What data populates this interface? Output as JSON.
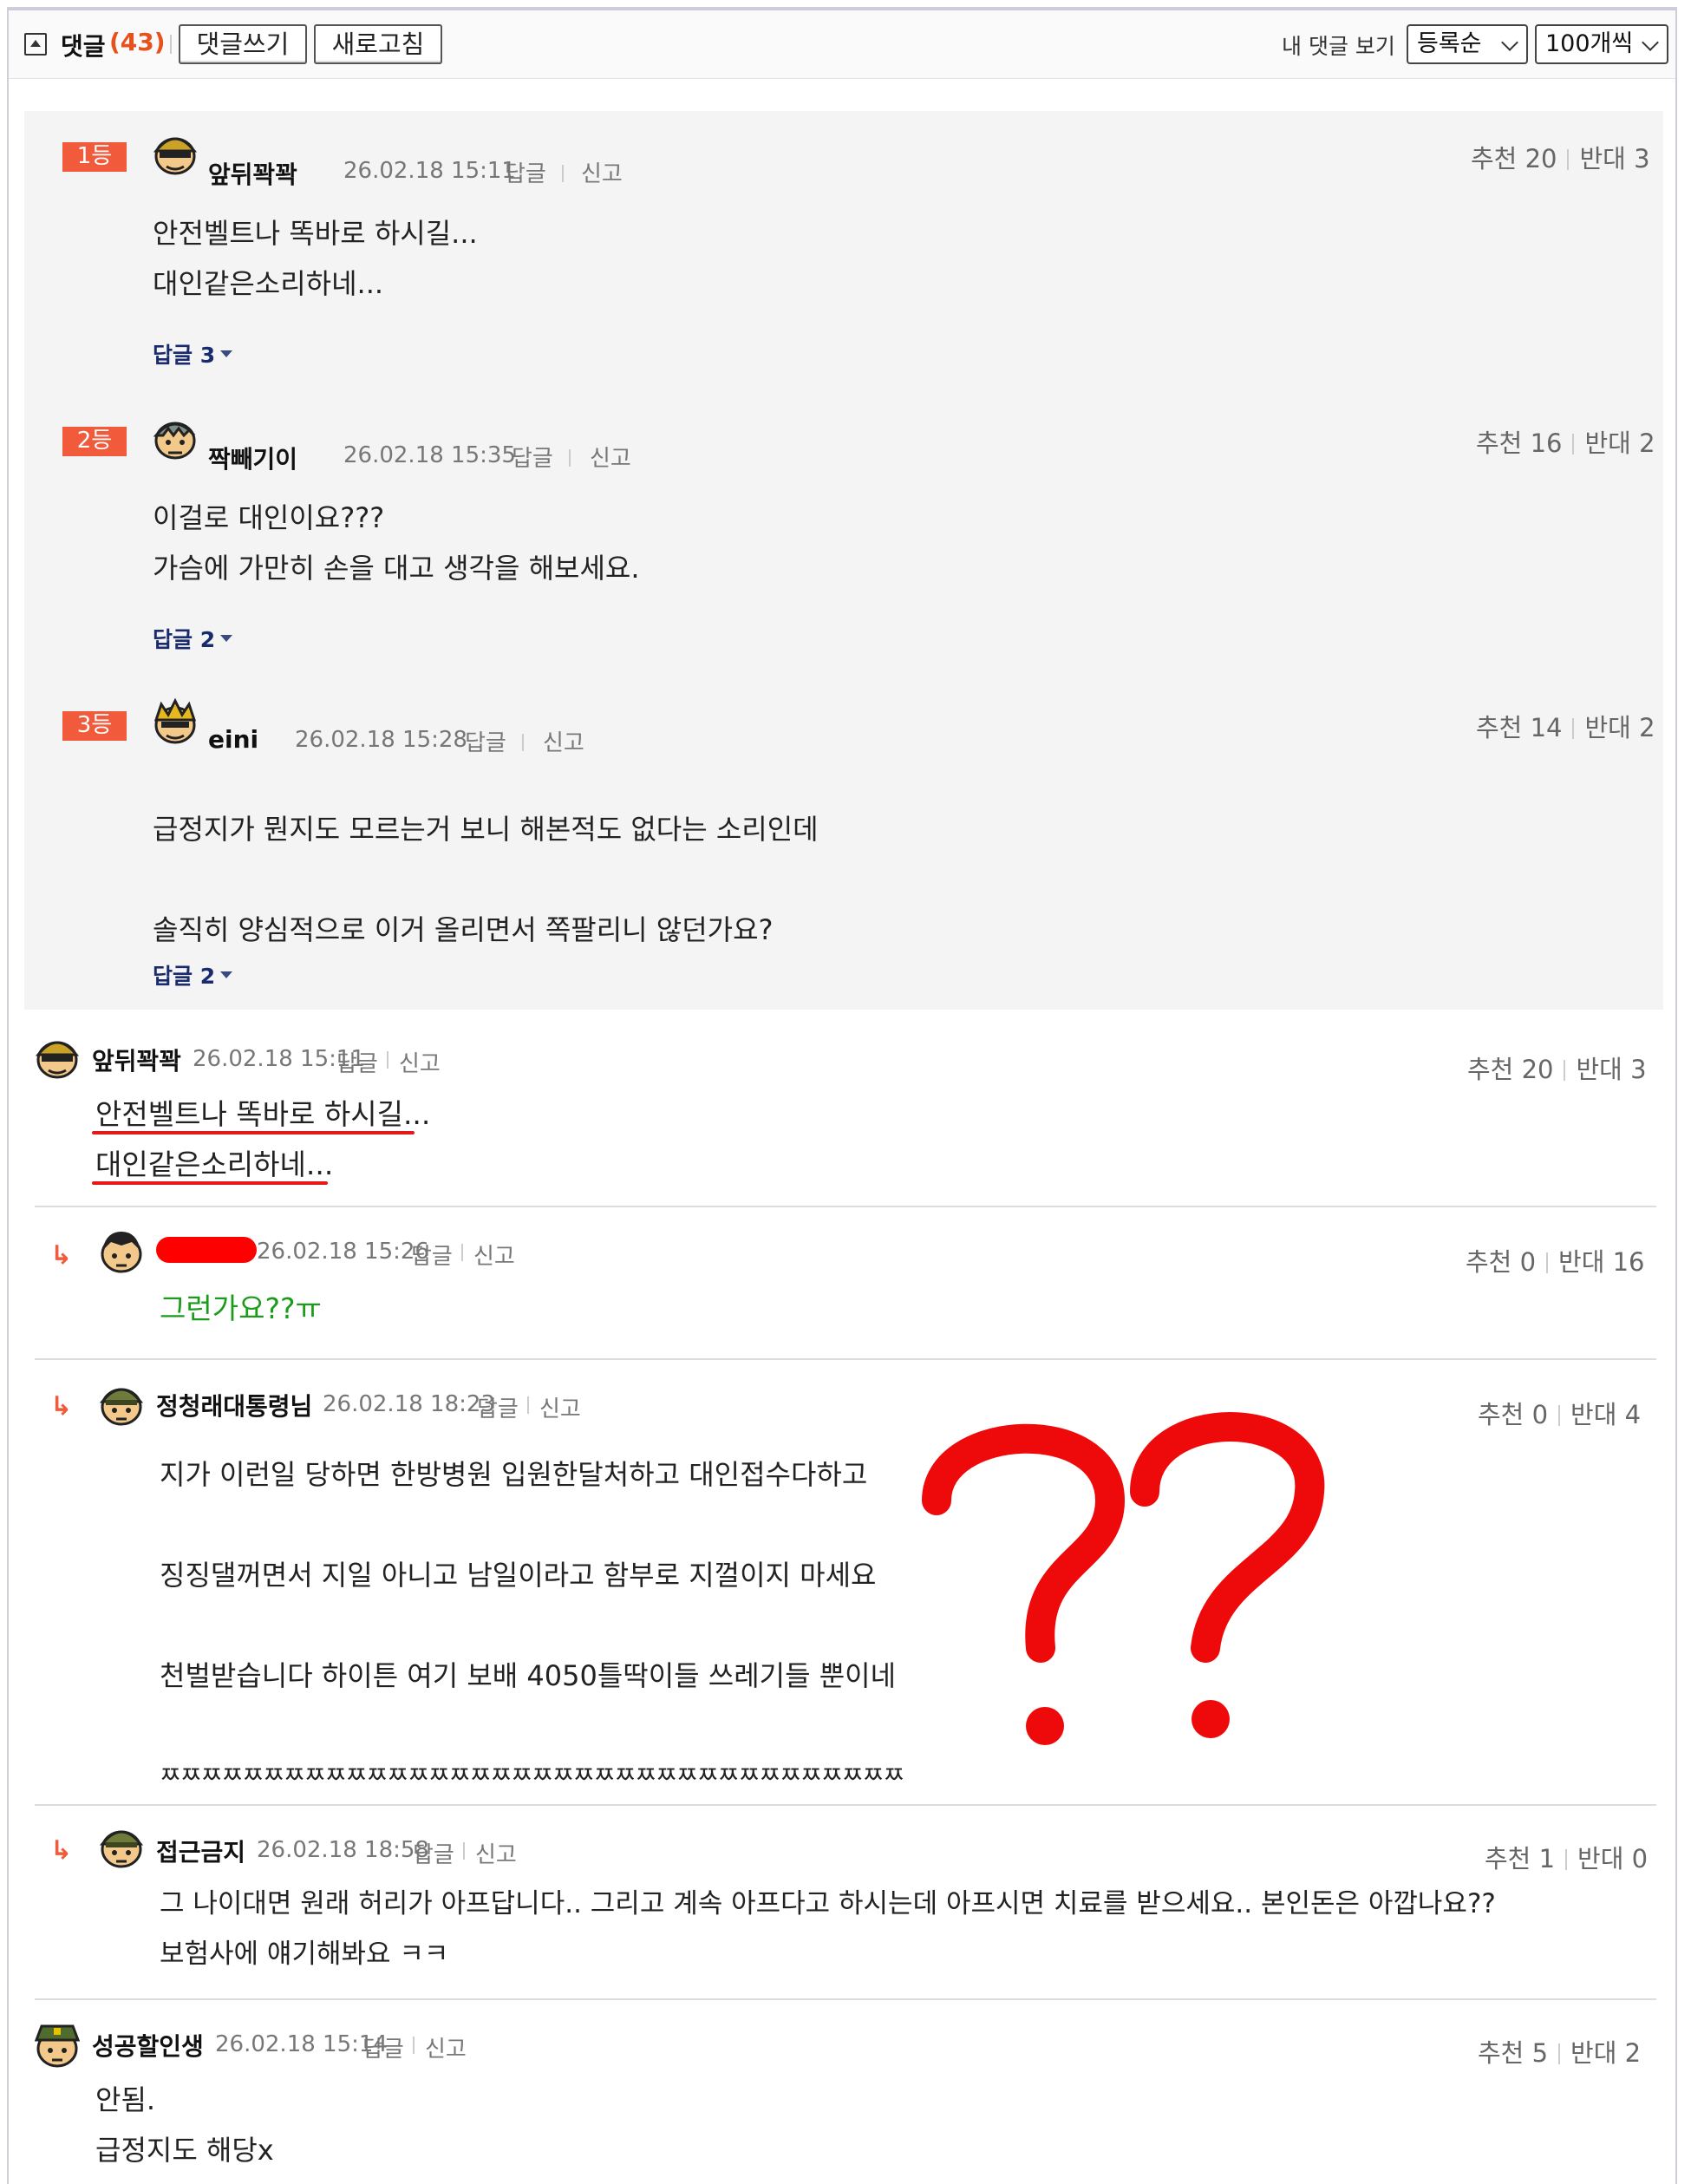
{
  "header": {
    "title": "댓글",
    "count": "(43)",
    "write_button": "댓글쓰기",
    "refresh_button": "새로고침",
    "my_comments": "내 댓글 보기",
    "sort_select": "등록순",
    "page_size_select": "100개씩"
  },
  "best_comments": [
    {
      "rank": "1등",
      "nick": "앞뒤꽉꽉",
      "date": "26.02.18 15:11",
      "reply_link": "답글",
      "report_link": "신고",
      "up": "추천 20",
      "down": "반대 3",
      "lines": [
        "안전벨트나 똑바로 하시길...",
        "대인같은소리하네..."
      ],
      "replies": "답글 3"
    },
    {
      "rank": "2등",
      "nick": "짝빼기이",
      "date": "26.02.18 15:35",
      "reply_link": "답글",
      "report_link": "신고",
      "up": "추천 16",
      "down": "반대 2",
      "lines": [
        "이걸로 대인이요???",
        "가슴에 가만히 손을 대고 생각을 해보세요."
      ],
      "replies": "답글 2"
    },
    {
      "rank": "3등",
      "nick": "eini",
      "date": "26.02.18 15:28",
      "reply_link": "답글",
      "report_link": "신고",
      "up": "추천 14",
      "down": "반대 2",
      "lines": [
        "급정지가 뭔지도 모르는거 보니 해본적도 없다는 소리인데",
        "솔직히 양심적으로 이거 올리면서 쪽팔리니 않던가요?"
      ],
      "replies": "답글 2"
    }
  ],
  "comments": [
    {
      "nick": "앞뒤꽉꽉",
      "date": "26.02.18 15:11",
      "reply_link": "답글",
      "report_link": "신고",
      "up": "추천 20",
      "down": "반대 3",
      "lines": [
        "안전벨트나 똑바로 하시길...",
        "대인같은소리하네..."
      ]
    },
    {
      "nick": "",
      "date": "26.02.18 15:26",
      "reply_link": "답글",
      "report_link": "신고",
      "up": "추천 0",
      "down": "반대 16",
      "lines": [
        "그런가요??ㅠ"
      ],
      "arrow": "↳"
    },
    {
      "nick": "정청래대통령님",
      "date": "26.02.18 18:23",
      "reply_link": "답글",
      "report_link": "신고",
      "up": "추천 0",
      "down": "반대 4",
      "lines": [
        "지가 이런일 당하면 한방병원 입원한달처하고 대인접수다하고",
        "징징댈꺼면서 지일 아니고 남일이라고 함부로 지껄이지 마세요",
        "천벌받습니다 하이튼 여기 보배 4050틀딱이들 쓰레기들 뿐이네",
        "ㅉㅉㅉㅉㅉㅉㅉㅉㅉㅉㅉㅉㅉㅉㅉㅉㅉㅉㅉㅉㅉㅉㅉㅉㅉㅉㅉㅉㅉㅉㅉㅉㅉㅉㅉㅉ"
      ],
      "arrow": "↳"
    },
    {
      "nick": "접근금지",
      "date": "26.02.18 18:58",
      "reply_link": "답글",
      "report_link": "신고",
      "up": "추천 1",
      "down": "반대 0",
      "lines": [
        "그 나이대면 원래 허리가 아프답니다.. 그리고 계속 아프다고 하시는데 아프시면 치료를 받으세요.. 본인돈은 아깝나요??",
        "보험사에 얘기해봐요 ㅋㅋ"
      ],
      "arrow": "↳"
    },
    {
      "nick": "성공할인생",
      "date": "26.02.18 15:14",
      "reply_link": "답글",
      "report_link": "신고",
      "up": "추천 5",
      "down": "반대 2",
      "lines": [
        "안됨.",
        "급정지도 해당x"
      ]
    }
  ],
  "colors": {
    "rank_badge": "#f15a3b",
    "count": "#e8501c",
    "reply_text": "#1a9b1a",
    "annotation_red": "#e41a1a"
  }
}
